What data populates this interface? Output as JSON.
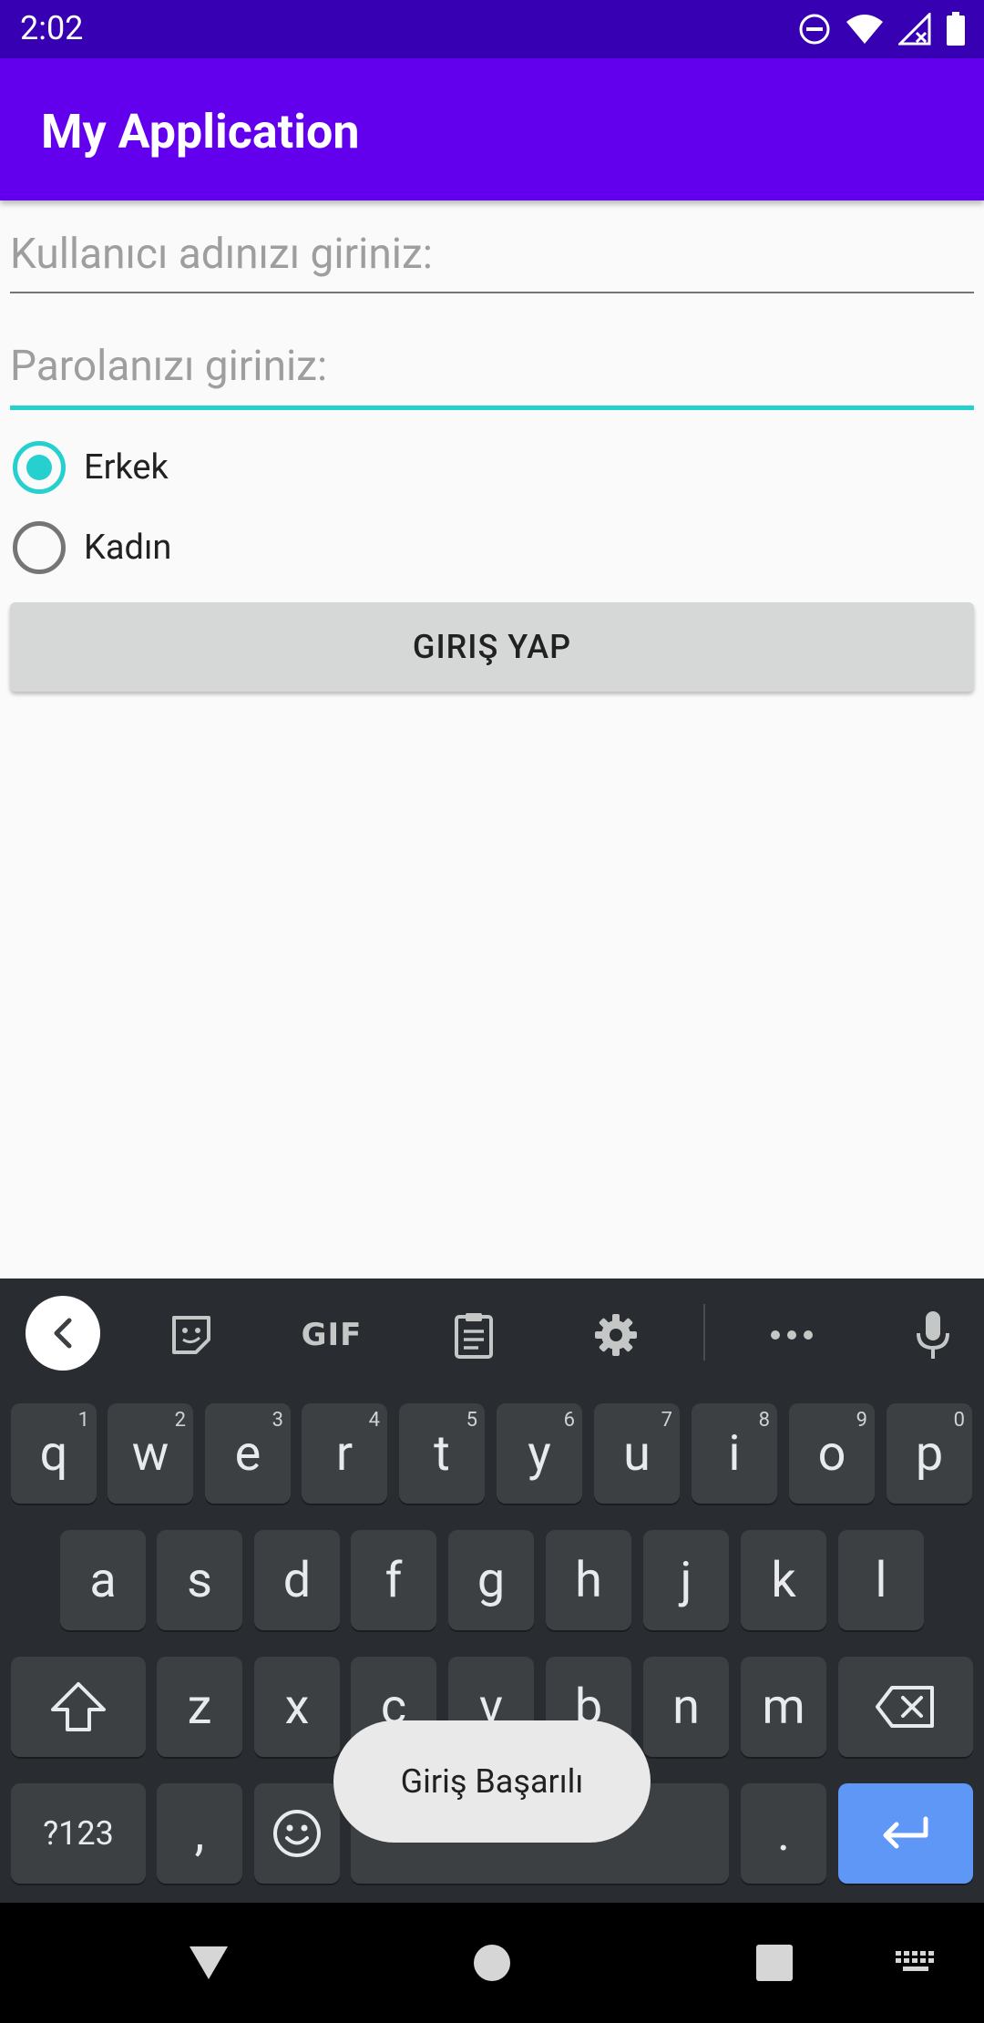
{
  "status_bar": {
    "time": "2:02"
  },
  "app_bar": {
    "title": "My Application"
  },
  "form": {
    "username_placeholder": "Kullanıcı adınızı giriniz:",
    "password_placeholder": "Parolanızı giriniz:",
    "gender_options": [
      {
        "label": "Erkek",
        "selected": true
      },
      {
        "label": "Kadın",
        "selected": false
      }
    ],
    "login_button": "GIRIŞ YAP"
  },
  "keyboard": {
    "toolbar_gif": "GIF",
    "row1": [
      {
        "key": "q",
        "sup": "1"
      },
      {
        "key": "w",
        "sup": "2"
      },
      {
        "key": "e",
        "sup": "3"
      },
      {
        "key": "r",
        "sup": "4"
      },
      {
        "key": "t",
        "sup": "5"
      },
      {
        "key": "y",
        "sup": "6"
      },
      {
        "key": "u",
        "sup": "7"
      },
      {
        "key": "i",
        "sup": "8"
      },
      {
        "key": "o",
        "sup": "9"
      },
      {
        "key": "p",
        "sup": "0"
      }
    ],
    "row2": [
      "a",
      "s",
      "d",
      "f",
      "g",
      "h",
      "j",
      "k",
      "l"
    ],
    "row3": [
      "z",
      "x",
      "c",
      "v",
      "b",
      "n",
      "m"
    ],
    "symbols_key": "?123",
    "comma_key": ",",
    "period_key": "."
  },
  "toast": {
    "message": "Giriş Başarılı"
  },
  "colors": {
    "accent": "#26d0ce",
    "app_bar": "#6200ee",
    "status_bar": "#3700b3",
    "enter_key": "#5e97f6"
  }
}
